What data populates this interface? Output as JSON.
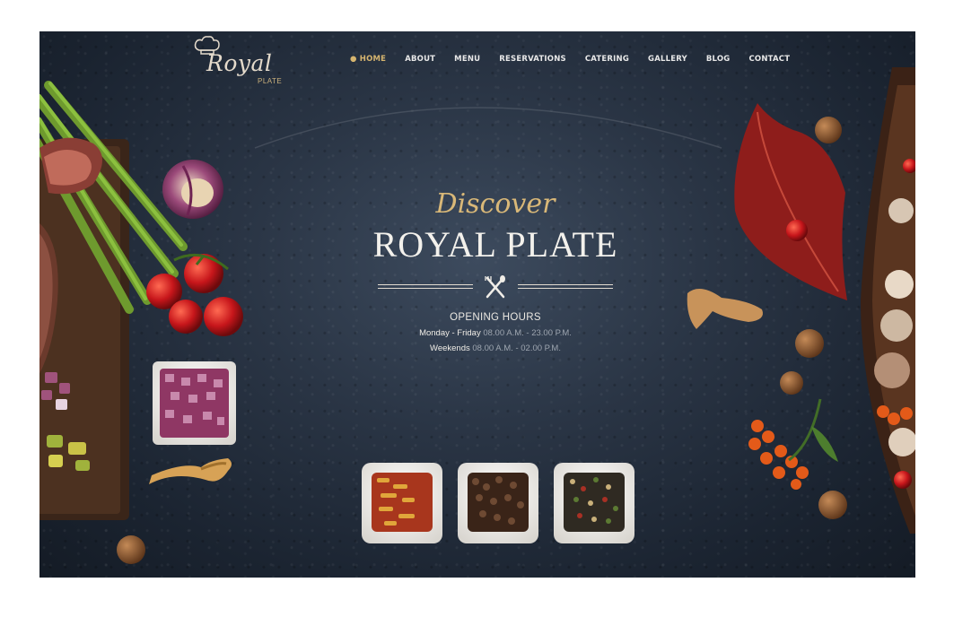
{
  "logo": {
    "script": "Royal",
    "sub": "PLATE"
  },
  "nav": {
    "items": [
      {
        "label": "HOME",
        "active": true
      },
      {
        "label": "ABOUT"
      },
      {
        "label": "MENU"
      },
      {
        "label": "RESERVATIONS"
      },
      {
        "label": "CATERING"
      },
      {
        "label": "GALLERY"
      },
      {
        "label": "BLOG"
      },
      {
        "label": "CONTACT"
      }
    ]
  },
  "hero": {
    "eyebrow": "Discover",
    "title": "ROYAL PLATE",
    "hours_title": "OPENING HOURS",
    "weekdays_label": "Monday - Friday",
    "weekdays_time": "08.00 A.M. - 23.00 P.M.",
    "weekends_label": "Weekends",
    "weekends_time": "08.00 A.M. - 02.00 P.M."
  },
  "colors": {
    "background": "#25303e",
    "accent_gold": "#d9b878",
    "text_light": "#f3f1ec"
  }
}
